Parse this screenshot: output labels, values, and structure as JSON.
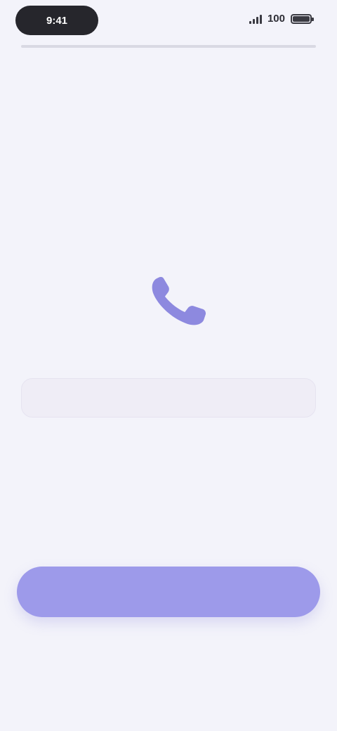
{
  "status_bar": {
    "time": "9:41",
    "battery": "100",
    "battery_level": 1.0
  },
  "header": {
    "title": "",
    "subtitle": ""
  },
  "illustration": {
    "icon": "phone-handset-icon",
    "caption": "",
    "color": "#8d89df"
  },
  "code_field": {
    "value": "",
    "placeholder": ""
  },
  "helper_link": "",
  "primary_button": {
    "label": "",
    "color": "#9d9aea"
  },
  "secondary_link": "",
  "colors": {
    "background": "#f3f3fa",
    "accent": "#9d9aea",
    "text_primary": "#1f1f26",
    "text_secondary": "#6b6b78"
  }
}
